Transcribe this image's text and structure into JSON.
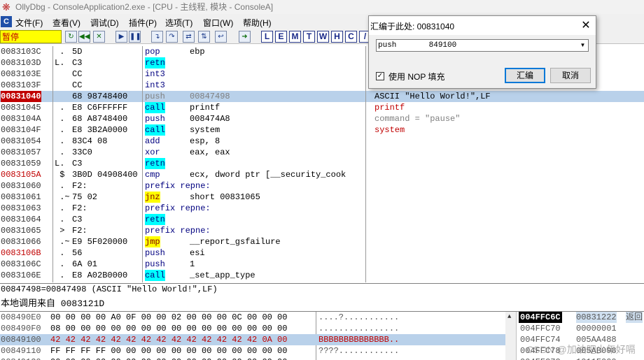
{
  "window": {
    "title": "OllyDbg - ConsoleApplication2.exe - [CPU - 主线程, 模块 - ConsoleA]",
    "app_icon": "bug-icon"
  },
  "menu": [
    "文件(F)",
    "查看(V)",
    "调试(D)",
    "插件(P)",
    "选项(T)",
    "窗口(W)",
    "帮助(H)"
  ],
  "toolbar": {
    "status": "暂停",
    "buttons": [
      "restart",
      "rewind",
      "close",
      "run",
      "pause",
      "step-into",
      "step-over",
      "trace-into",
      "trace-over",
      "execute-till-return",
      "goto"
    ],
    "letters": [
      "L",
      "E",
      "M",
      "T",
      "W",
      "H",
      "C",
      "/"
    ]
  },
  "disasm": {
    "rows": [
      {
        "addr": "0083103C",
        "mark": " .",
        "hex": "5D",
        "mn": "pop",
        "op": "ebp",
        "cm": ""
      },
      {
        "addr": "0083103D",
        "mark": "L.",
        "hex": "C3",
        "mn": "retn",
        "op": "",
        "cm": ""
      },
      {
        "addr": "0083103E",
        "mark": "",
        "hex": "CC",
        "mn": "int3",
        "op": "",
        "cm": ""
      },
      {
        "addr": "0083103F",
        "mark": "",
        "hex": "CC",
        "mn": "int3",
        "op": "",
        "cm": ""
      },
      {
        "addr": "00831040",
        "mark": "",
        "hex": "68 98748400",
        "mn": "push",
        "op": "00847498",
        "cm": "ASCII \"Hello World!\",LF"
      },
      {
        "addr": "00831045",
        "mark": " .",
        "hex": "E8 C6FFFFFF",
        "mn": "call",
        "op": "printf",
        "cm": "printf"
      },
      {
        "addr": "0083104A",
        "mark": " .",
        "hex": "68 A8748400",
        "mn": "push",
        "op": "008474A8",
        "cm": "command = \"pause\""
      },
      {
        "addr": "0083104F",
        "mark": " .",
        "hex": "E8 3B2A0000",
        "mn": "call",
        "op": "system",
        "cm": "system"
      },
      {
        "addr": "00831054",
        "mark": " .",
        "hex": "83C4 08",
        "mn": "add",
        "op": "esp, 8",
        "cm": ""
      },
      {
        "addr": "00831057",
        "mark": " .",
        "hex": "33C0",
        "mn": "xor",
        "op": "eax, eax",
        "cm": ""
      },
      {
        "addr": "00831059",
        "mark": "L.",
        "hex": "C3",
        "mn": "retn",
        "op": "",
        "cm": ""
      },
      {
        "addr": "0083105A",
        "mark": " $",
        "hex": "3B0D 04908400",
        "mn": "cmp",
        "op": "ecx, dword ptr [__security_cook",
        "cm": ""
      },
      {
        "addr": "00831060",
        "mark": " .",
        "hex": "F2:",
        "mn": "prefix repne:",
        "op": "",
        "cm": ""
      },
      {
        "addr": "00831061",
        "mark": " .~",
        "hex": "75 02",
        "mn": "jnz",
        "op": "short 00831065",
        "cm": ""
      },
      {
        "addr": "00831063",
        "mark": " .",
        "hex": "F2:",
        "mn": "prefix repne:",
        "op": "",
        "cm": ""
      },
      {
        "addr": "00831064",
        "mark": " .",
        "hex": "C3",
        "mn": "retn",
        "op": "",
        "cm": ""
      },
      {
        "addr": "00831065",
        "mark": " >",
        "hex": "F2:",
        "mn": "prefix repne:",
        "op": "",
        "cm": ""
      },
      {
        "addr": "00831066",
        "mark": " .~",
        "hex": "E9 5F020000",
        "mn": "jmp",
        "op": "__report_gsfailure",
        "cm": ""
      },
      {
        "addr": "0083106B",
        "mark": " .",
        "hex": "56",
        "mn": "push",
        "op": "esi",
        "cm": ""
      },
      {
        "addr": "0083106C",
        "mark": " .",
        "hex": "6A 01",
        "mn": "push",
        "op": "1",
        "cm": ""
      },
      {
        "addr": "0083106E",
        "mark": " .",
        "hex": "E8 A02B0000",
        "mn": "call",
        "op": "_set_app_type",
        "cm": ""
      }
    ]
  },
  "info": {
    "line1": "00847498=00847498 (ASCII \"Hello World!\",LF)",
    "line2": "本地调用来自  0083121D"
  },
  "dump": {
    "rows": [
      {
        "addr": "008490E0",
        "hex": "00 00 00 00 A0 0F 00 00 02 00 00 00 0C 00 00 00",
        "text": "....?...........",
        "sel": false
      },
      {
        "addr": "008490F0",
        "hex": "08 00 00 00 00 00 00 00 00 00 00 00 00 00 00 00",
        "text": "................",
        "sel": false
      },
      {
        "addr": "00849100",
        "hex": "42 42 42 42 42 42 42 42 42 42 42 42 42 42 0A 00",
        "text": "BBBBBBBBBBBBBB..",
        "sel": true
      },
      {
        "addr": "00849110",
        "hex": "FF FF FF FF 00 00 00 00 00 00 00 00 00 00 00 00",
        "text": "????............",
        "sel": false
      },
      {
        "addr": "00849120",
        "hex": "00 00 00 00 00 00 00 00 00 00 00 00 00 00 00 00",
        "text": "................",
        "sel": false
      }
    ]
  },
  "stack": {
    "rows": [
      {
        "addr": "004FFC6C",
        "val": "00831222",
        "cm": "返回",
        "sel": true
      },
      {
        "addr": "004FFC70",
        "val": "00000001",
        "cm": "",
        "sel": false
      },
      {
        "addr": "004FFC74",
        "val": "005AA488",
        "cm": "",
        "sel": false
      },
      {
        "addr": "004FFC78",
        "val": "005AB098",
        "cm": "",
        "sel": false
      },
      {
        "addr": "004FFC7C",
        "val": "1011F000",
        "cm": "",
        "sel": false
      }
    ]
  },
  "watermark": "CSDN @加油吧少年好嗝",
  "dialog": {
    "title": "汇编于此处: 00831040",
    "input_value": "push       849100",
    "nop_label": "使用 NOP 填充",
    "nop_checked": true,
    "assemble_label": "汇编",
    "cancel_label": "取消"
  }
}
